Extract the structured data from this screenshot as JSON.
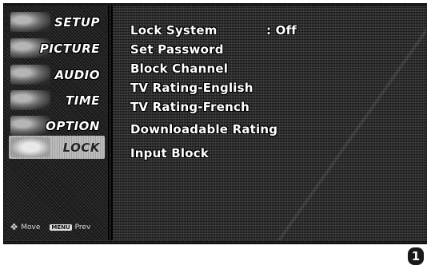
{
  "menu": {
    "items": [
      {
        "label": "SETUP"
      },
      {
        "label": "PICTURE"
      },
      {
        "label": "AUDIO"
      },
      {
        "label": "TIME"
      },
      {
        "label": "OPTION"
      },
      {
        "label": "LOCK"
      }
    ],
    "selected_index": 5,
    "footer": {
      "move_label": "Move",
      "menu_key_label": "MENU",
      "prev_label": "Prev"
    }
  },
  "lock_panel": {
    "options": [
      {
        "label": "Lock System",
        "value": ": Off"
      },
      {
        "label": "Set Password"
      },
      {
        "label": "Block Channel"
      },
      {
        "label": "TV Rating-English"
      },
      {
        "label": "TV Rating-French"
      },
      {
        "label": "Downloadable Rating"
      },
      {
        "label": "Input Block"
      }
    ]
  },
  "step_badge": "1"
}
